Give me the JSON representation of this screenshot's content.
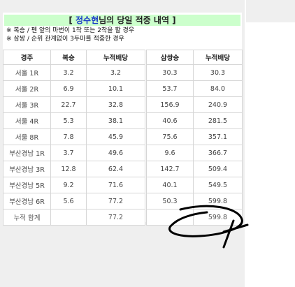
{
  "header": {
    "bracket_open": "[ ",
    "name": "정수현",
    "title_rest": "님의 당일 적중 내역 ]"
  },
  "notes": [
    "※ 복승 / 펜 앞의 마번이 1착 또는 2착을 할 경우",
    "※ 삼쌍 / 순위 관계없이 3두마를 적중한 경우"
  ],
  "left_table": {
    "headers": [
      "경주",
      "복승",
      "누적배당"
    ],
    "rows": [
      [
        "서울 1R",
        "3.2",
        "3.2"
      ],
      [
        "서울 2R",
        "6.9",
        "10.1"
      ],
      [
        "서울 3R",
        "22.7",
        "32.8"
      ],
      [
        "서울 4R",
        "5.3",
        "38.1"
      ],
      [
        "서울 8R",
        "7.8",
        "45.9"
      ],
      [
        "부산경남 1R",
        "3.7",
        "49.6"
      ],
      [
        "부산경남 3R",
        "12.8",
        "62.4"
      ],
      [
        "부산경남 5R",
        "9.2",
        "71.6"
      ],
      [
        "부산경남 6R",
        "5.6",
        "77.2"
      ]
    ],
    "total": [
      "누적 합계",
      "",
      "77.2"
    ]
  },
  "right_table": {
    "headers": [
      "삼쌍승",
      "누적배당"
    ],
    "rows": [
      [
        "30.3",
        "30.3"
      ],
      [
        "53.7",
        "84.0"
      ],
      [
        "156.9",
        "240.9"
      ],
      [
        "40.6",
        "281.5"
      ],
      [
        "75.6",
        "357.1"
      ],
      [
        "9.6",
        "366.7"
      ],
      [
        "142.7",
        "509.4"
      ],
      [
        "40.1",
        "549.5"
      ],
      [
        "50.3",
        "599.8"
      ]
    ],
    "total": [
      "",
      "599.8"
    ]
  },
  "colors": {
    "title_bg": "#ccffcc",
    "name_color": "#1a3cc8",
    "total_blue": "#2233bb",
    "scribble": "#000000"
  }
}
